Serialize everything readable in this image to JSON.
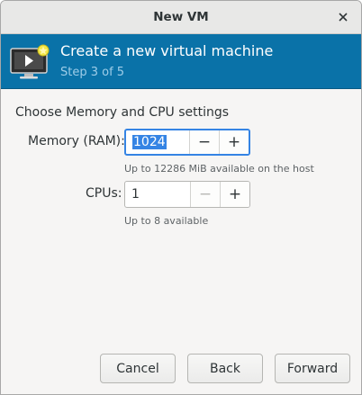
{
  "window": {
    "title": "New VM"
  },
  "header": {
    "title": "Create a new virtual machine",
    "step": "Step 3 of 5",
    "icon": "vm-monitor-new-icon",
    "background": "#0a72a8"
  },
  "main": {
    "section_title": "Choose Memory and CPU settings",
    "memory": {
      "label": "Memory (RAM):",
      "value": "1024",
      "hint": "Up to 12286 MiB available on the host"
    },
    "cpus": {
      "label": "CPUs:",
      "value": "1",
      "hint": "Up to 8 available"
    }
  },
  "footer": {
    "cancel": "Cancel",
    "back": "Back",
    "forward": "Forward"
  }
}
